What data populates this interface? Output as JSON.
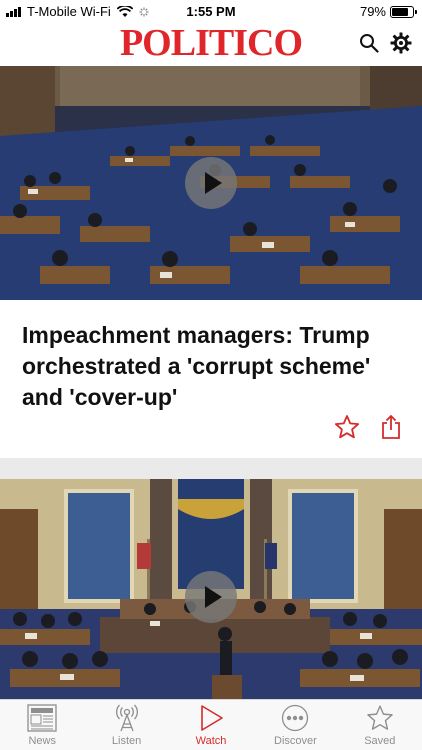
{
  "status_bar": {
    "carrier": "T-Mobile Wi-Fi",
    "time": "1:55 PM",
    "battery": "79%",
    "battery_level": 0.79
  },
  "header": {
    "logo": "POLITICO",
    "icons": [
      "search-icon",
      "gear-icon"
    ]
  },
  "feed": {
    "stories": [
      {
        "headline": "Impeachment managers: Trump orchestrated a 'corrupt scheme' and 'cover-up'",
        "actions": [
          "star-icon",
          "share-icon"
        ]
      }
    ]
  },
  "tab_bar": {
    "tabs": [
      {
        "label": "News",
        "icon": "newspaper-icon"
      },
      {
        "label": "Listen",
        "icon": "broadcast-icon"
      },
      {
        "label": "Watch",
        "icon": "play-icon",
        "active": true
      },
      {
        "label": "Discover",
        "icon": "ellipsis-circle-icon"
      },
      {
        "label": "Saved",
        "icon": "star-icon"
      }
    ]
  },
  "colors": {
    "brand_red": "#e0262b",
    "active_tab": "#d62b2b"
  }
}
